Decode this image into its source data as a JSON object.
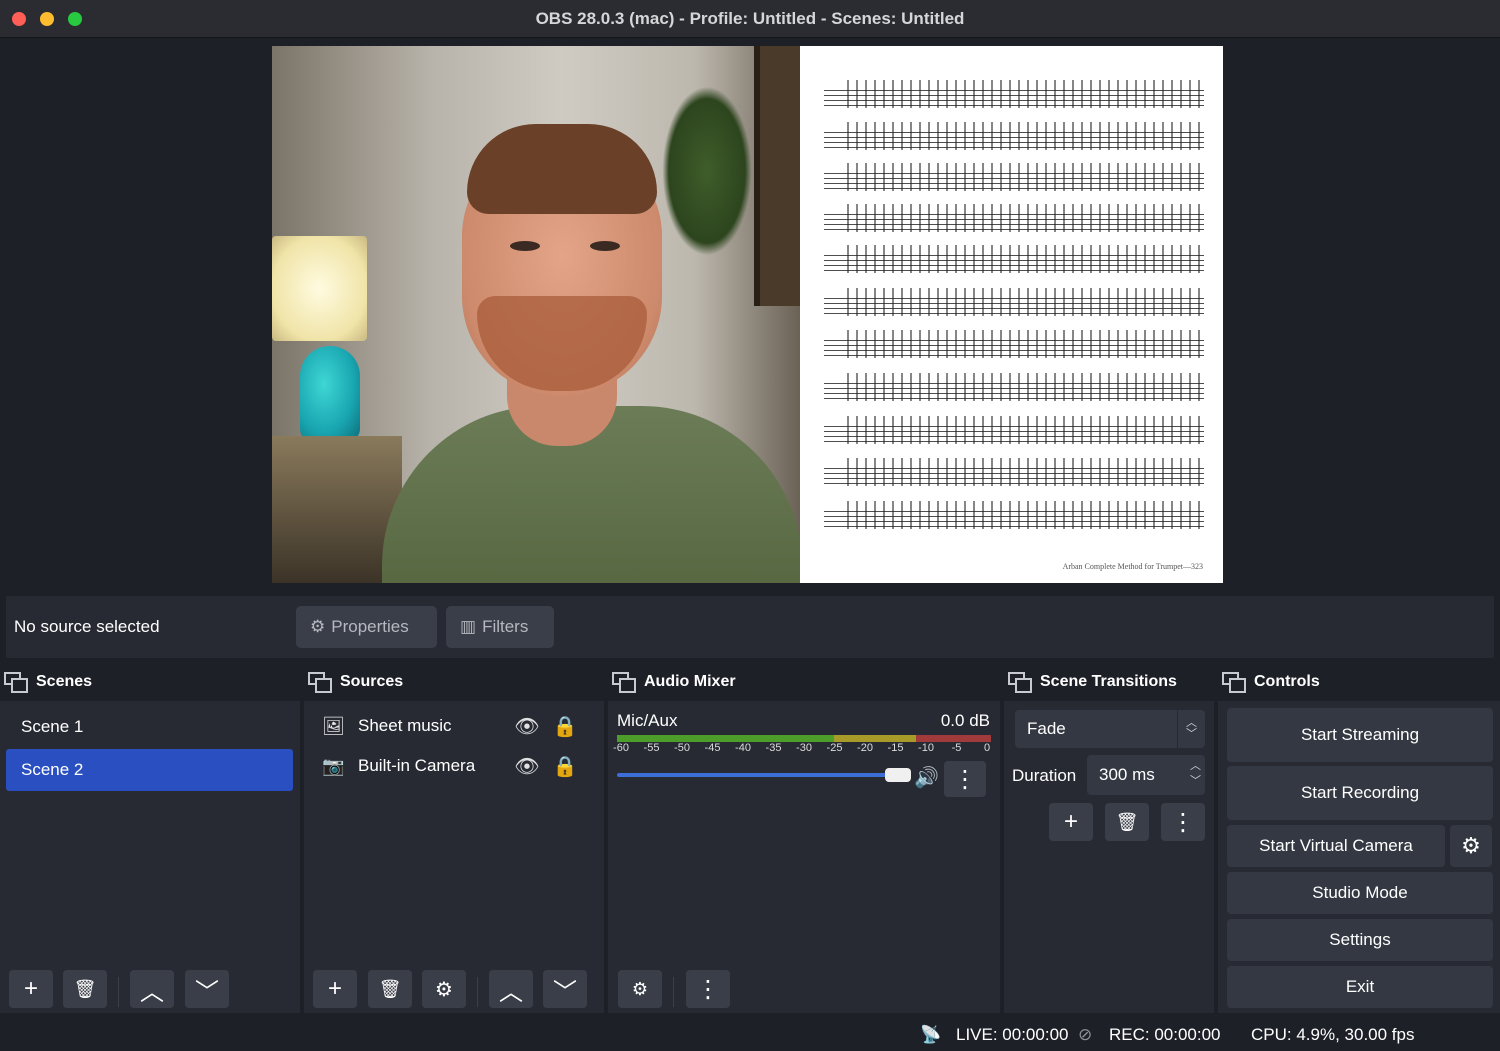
{
  "window": {
    "title": "OBS 28.0.3 (mac) - Profile: Untitled - Scenes: Untitled"
  },
  "preview": {
    "sheet_footer": "Arban Complete Method for Trumpet—323"
  },
  "source_toolbar": {
    "status": "No source selected",
    "properties_label": "Properties",
    "filters_label": "Filters"
  },
  "scenes": {
    "title": "Scenes",
    "items": [
      {
        "label": "Scene 1",
        "active": false
      },
      {
        "label": "Scene 2",
        "active": true
      }
    ]
  },
  "sources": {
    "title": "Sources",
    "items": [
      {
        "label": "Sheet music",
        "icon": "image-icon"
      },
      {
        "label": "Built-in Camera",
        "icon": "camera-icon"
      }
    ]
  },
  "audio_mixer": {
    "title": "Audio Mixer",
    "channel": {
      "name": "Mic/Aux",
      "level": "0.0 dB",
      "volume_fraction": 1.0
    },
    "scale": [
      "-60",
      "-55",
      "-50",
      "-45",
      "-40",
      "-35",
      "-30",
      "-25",
      "-20",
      "-15",
      "-10",
      "-5",
      "0"
    ]
  },
  "transitions": {
    "title": "Scene Transitions",
    "selected": "Fade",
    "duration_label": "Duration",
    "duration_value": "300 ms"
  },
  "controls": {
    "title": "Controls",
    "start_streaming": "Start Streaming",
    "start_recording": "Start Recording",
    "start_virtual_camera": "Start Virtual Camera",
    "studio_mode": "Studio Mode",
    "settings": "Settings",
    "exit": "Exit"
  },
  "status": {
    "live": "LIVE: 00:00:00",
    "rec": "REC: 00:00:00",
    "cpu": "CPU: 4.9%, 30.00 fps"
  },
  "colors": {
    "accent": "#2a4fc0",
    "panel": "#272a33",
    "background": "#1e2028",
    "button": "#343842"
  }
}
